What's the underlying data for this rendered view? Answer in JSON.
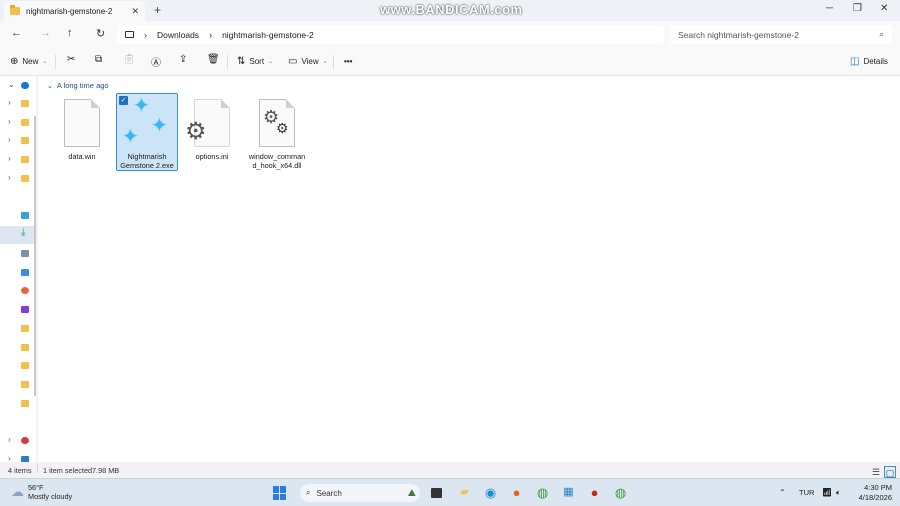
{
  "tab": {
    "title": "nightmarish-gemstone-2",
    "close": "✕",
    "new_tab": "+"
  },
  "watermark": "www.BANDICAM.com",
  "window_controls": {
    "minimize": "─",
    "maximize": "❐",
    "close": "✕"
  },
  "address": {
    "breadcrumbs": [
      "Downloads",
      "nightmarish-gemstone-2"
    ],
    "search_placeholder": "Search nightmarish-gemstone-2"
  },
  "commands": {
    "new": "New",
    "sort": "Sort",
    "view": "View",
    "more": "•••",
    "details": "Details"
  },
  "group_header": "A long time ago",
  "files": [
    {
      "name": "data.win",
      "type": "document",
      "selected": false
    },
    {
      "name_line1": "Nightmarish",
      "name_line2": "Gemstone 2.exe",
      "type": "exe",
      "selected": true
    },
    {
      "name": "options.ini",
      "type": "settings",
      "selected": false
    },
    {
      "name_line1": "window_comman",
      "name_line2": "d_hook_x64.dll",
      "type": "dll",
      "selected": false
    }
  ],
  "status": {
    "items": "4 items",
    "selection": "1 item selected",
    "size": "7.98 MB"
  },
  "taskbar": {
    "weather_temp": "56°F",
    "weather_desc": "Mostly cloudy",
    "search": "Search",
    "language": "TUR",
    "time": "4:30 PM",
    "date": "4/18/2026"
  },
  "colors": {
    "accent": "#1f6fc5",
    "selection_bg": "#cce4f7",
    "folder": "#f5c04a"
  }
}
